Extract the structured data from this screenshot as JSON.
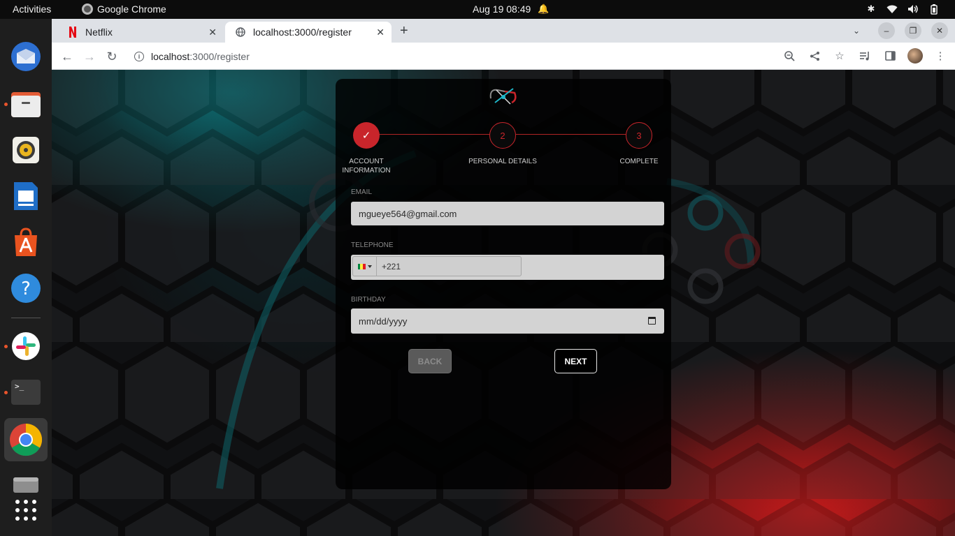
{
  "topbar": {
    "activities": "Activities",
    "app_name": "Google Chrome",
    "clock": "Aug 19  08:49"
  },
  "dock": {
    "items": [
      "thunderbird-icon",
      "files-icon",
      "rhythmbox-icon",
      "writer-icon",
      "app-center-icon",
      "help-icon",
      "slack-icon",
      "terminal-icon",
      "chrome-icon",
      "disk-icon",
      "show-apps-icon"
    ]
  },
  "browser": {
    "tabs": [
      {
        "label": "Netflix",
        "active": false
      },
      {
        "label": "localhost:3000/register",
        "active": true
      }
    ],
    "url_host": "localhost",
    "url_path": ":3000/register"
  },
  "form": {
    "steps": [
      {
        "label": "ACCOUNT INFORMATION",
        "marker": "✓",
        "state": "done"
      },
      {
        "label": "PERSONAL DETAILS",
        "marker": "2",
        "state": "todo"
      },
      {
        "label": "COMPLETE",
        "marker": "3",
        "state": "todo"
      }
    ],
    "email_label": "EMAIL",
    "email_value": "mgueye564@gmail.com",
    "telephone_label": "TELEPHONE",
    "telephone_value": "+221",
    "birthday_label": "BIRTHDAY",
    "birthday_placeholder": "mm/dd/yyyy",
    "back_label": "BACK",
    "next_label": "NEXT"
  },
  "colors": {
    "accent_red": "#c8252b",
    "page_bg": "#101113",
    "field_bg": "#d3d3d3"
  }
}
